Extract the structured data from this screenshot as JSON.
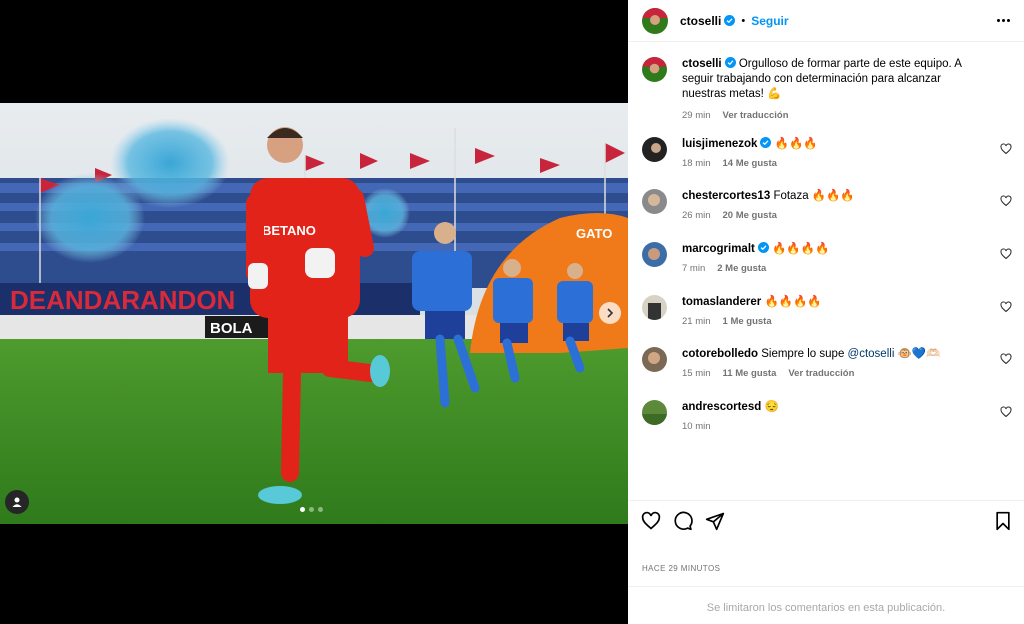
{
  "post": {
    "username": "ctoselli",
    "follow_label": "Seguir",
    "separator": "•",
    "caption": {
      "username": "ctoselli",
      "text": "Orgulloso de formar parte de este equipo. A seguir trabajando con determinación para alcanzar nuestras metas! 💪",
      "time": "29 min",
      "translate_label": "Ver traducción"
    },
    "posted_ago": "HACE 29 MINUTOS",
    "comments_limited": "Se limitaron los comentarios en esta publicación.",
    "carousel": {
      "slide": 1,
      "total": 3
    }
  },
  "photo_text": {
    "jersey_sponsor": "BETANO",
    "banner_left": "DEANDARANDON",
    "banner_ad": "BOLA",
    "inflatable": "GATO"
  },
  "comments": [
    {
      "username": "luisjimenezok",
      "verified": true,
      "text": "🔥🔥🔥",
      "time": "18 min",
      "likes": "14 Me gusta",
      "translate": ""
    },
    {
      "username": "chestercortes13",
      "verified": false,
      "text": "Fotaza 🔥🔥🔥",
      "time": "26 min",
      "likes": "20 Me gusta",
      "translate": ""
    },
    {
      "username": "marcogrimalt",
      "verified": true,
      "text": "🔥🔥🔥🔥",
      "time": "7 min",
      "likes": "2 Me gusta",
      "translate": ""
    },
    {
      "username": "tomaslanderer",
      "verified": false,
      "text": "🔥🔥🔥🔥",
      "time": "21 min",
      "likes": "1 Me gusta",
      "translate": ""
    },
    {
      "username": "cotorebolledo",
      "verified": false,
      "text": "Siempre lo supe",
      "mention": "@ctoselli",
      "emoji": "🐵💙🫶🏻",
      "time": "15 min",
      "likes": "11 Me gusta",
      "translate": "Ver traducción"
    },
    {
      "username": "andrescortesd",
      "verified": false,
      "text": "😔",
      "time": "10 min",
      "likes": "",
      "translate": ""
    }
  ],
  "colors": {
    "accent": "#0095f6",
    "muted": "#737373",
    "border": "#efefef"
  }
}
